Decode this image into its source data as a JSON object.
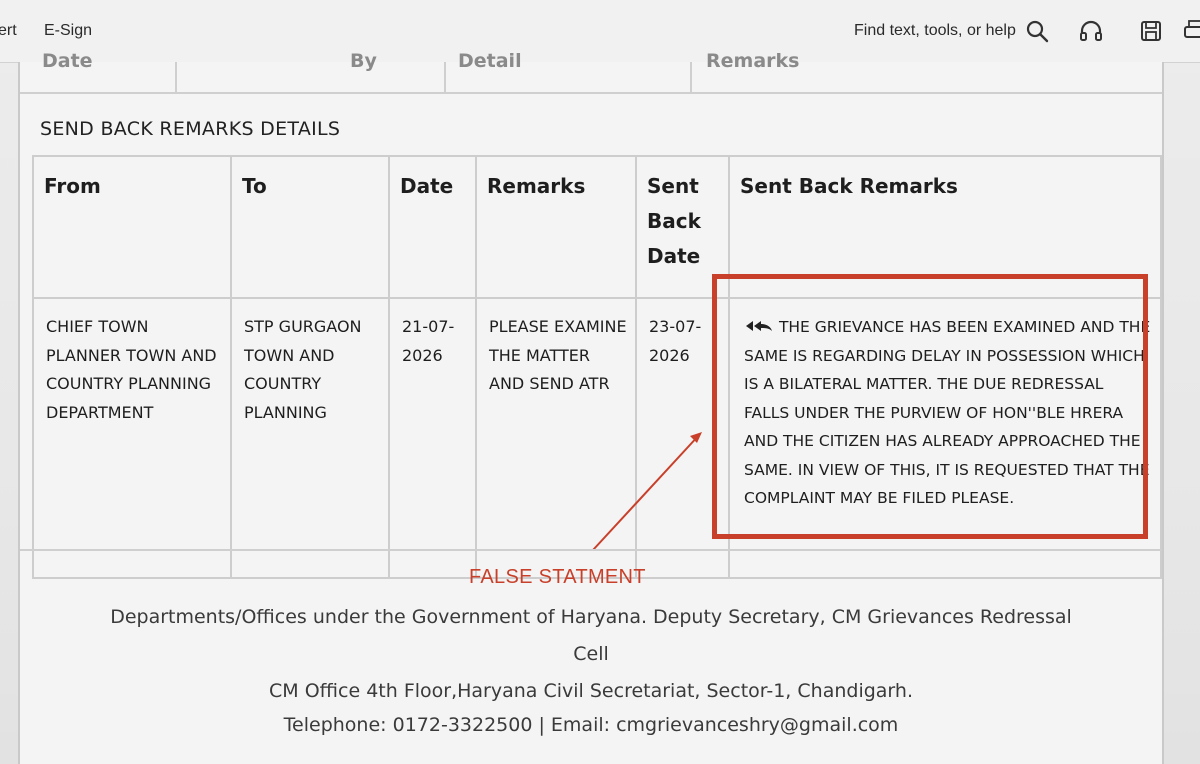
{
  "toolbar": {
    "left_menu_partial": "ert",
    "esign_label": "E-Sign",
    "search_label": "Find text, tools, or help"
  },
  "previous_table_partial_headers": [
    "Date",
    "By",
    "Detail",
    "Remarks"
  ],
  "section_title": "SEND BACK REMARKS DETAILS",
  "table": {
    "headers": [
      "From",
      "To",
      "Date",
      "Remarks",
      "Sent Back Date",
      "Sent Back Remarks"
    ],
    "row": {
      "from": "CHIEF TOWN PLANNER TOWN AND COUNTRY PLANNING DEPARTMENT",
      "to": "STP GURGAON TOWN AND COUNTRY PLANNING",
      "date": "21-07-2026",
      "remarks": "PLEASE EXAMINE THE MATTER AND SEND ATR",
      "sent_back_date": "23-07-2026",
      "sent_back_remarks": "THE GRIEVANCE HAS BEEN EXAMINED AND THE SAME IS REGARDING DELAY IN POSSESSION WHICH IS A BILATERAL MATTER. THE DUE REDRESSAL FALLS UNDER THE PURVIEW OF HON''BLE HRERA AND THE CITIZEN HAS ALREADY APPROACHED THE SAME. IN VIEW OF THIS, IT IS REQUESTED THAT THE COMPLAINT MAY BE FILED PLEASE."
    }
  },
  "annotation": {
    "text": "FALSE STATMENT",
    "color": "#c8402a"
  },
  "footer": {
    "line1": "Departments/Offices under the Government of Haryana. Deputy Secretary, CM Grievances Redressal",
    "line2": "Cell",
    "line3": "CM Office 4th Floor,Haryana Civil Secretariat, Sector-1, Chandigarh.",
    "line4": "Telephone: 0172-3322500 | Email: cmgrievanceshry@gmail.com"
  },
  "icons": [
    "search-icon",
    "headphones-icon",
    "save-icon",
    "print-icon",
    "reply-arrow-icon"
  ]
}
